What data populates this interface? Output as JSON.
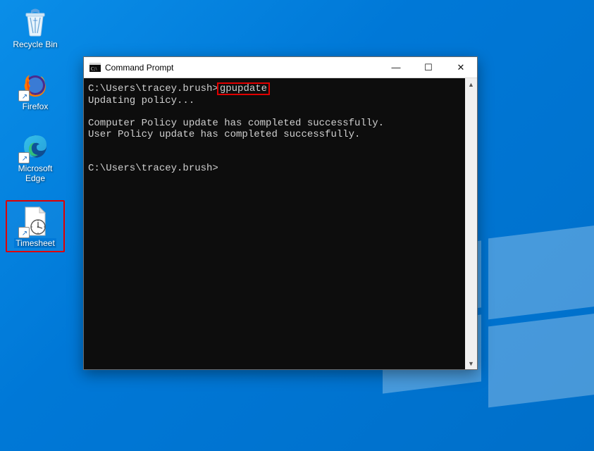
{
  "desktop": {
    "icons": [
      {
        "label": "Recycle Bin"
      },
      {
        "label": "Firefox"
      },
      {
        "label": "Microsoft Edge"
      },
      {
        "label": "Timesheet"
      }
    ]
  },
  "cmd": {
    "title": "Command Prompt",
    "prompt1_prefix": "C:\\Users\\tracey.brush>",
    "prompt1_cmd": "gpupdate",
    "line_updating": "Updating policy...",
    "line_computer": "Computer Policy update has completed successfully.",
    "line_user": "User Policy update has completed successfully.",
    "prompt2": "C:\\Users\\tracey.brush>"
  },
  "window_controls": {
    "minimize": "—",
    "maximize": "☐",
    "close": "✕"
  },
  "scrollbar": {
    "up": "▲",
    "down": "▼"
  }
}
